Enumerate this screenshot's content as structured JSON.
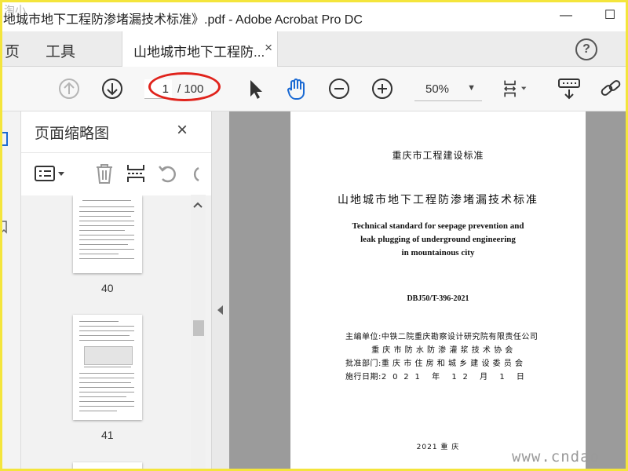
{
  "window": {
    "title": "地城市地下工程防渗堵漏技术标准》.pdf - Adobe Acrobat Pro DC",
    "minimize": "—",
    "maximize": "☐"
  },
  "menu": {
    "home": "页",
    "tools": "工具"
  },
  "doc_tab": {
    "label": "山地城市地下工程防...",
    "close": "×"
  },
  "help": "?",
  "toolbar": {
    "current_page": "1",
    "total_pages": "/ 100",
    "zoom": "50%",
    "caret": "▼"
  },
  "pane": {
    "title": "页面缩略图",
    "close": "×",
    "thumbnails": [
      {
        "page": "40"
      },
      {
        "page": "41"
      }
    ]
  },
  "document": {
    "line1": "重庆市工程建设标准",
    "line2": "山地城市地下工程防渗堵漏技术标准",
    "english": [
      "Technical standard for seepage prevention and",
      "leak plugging of underground engineering",
      "in mountainous city"
    ],
    "code": "DBJ50/T-396-2021",
    "info": [
      "主编单位:中铁二院重庆勘察设计研究院有限责任公司",
      "         重 庆 市 防 水 防 渗 灌 浆 技 术 协 会",
      "批准部门:重 庆 市 住 房 和 城 乡 建 设 委 员 会",
      "施行日期:2  0  2  1    年    1  2    月    1    日"
    ],
    "footer": "2021  重  庆"
  },
  "watermark": "www.cndao",
  "logo_text": "淘小"
}
